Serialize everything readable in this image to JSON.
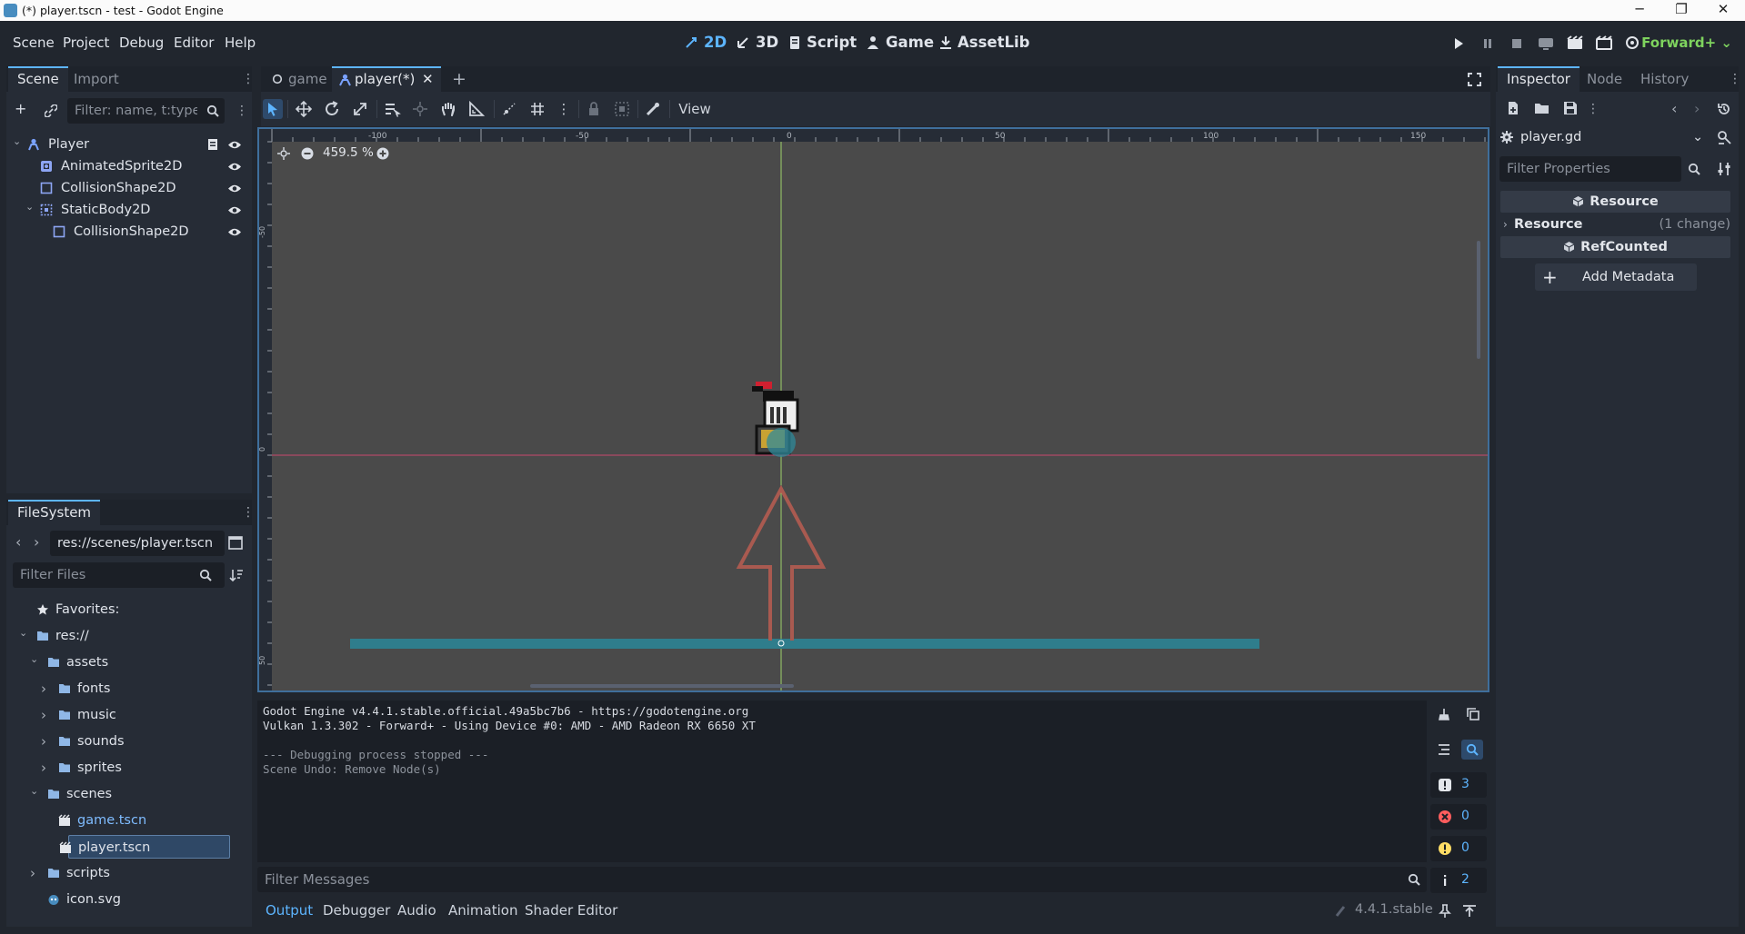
{
  "window": {
    "title": "(*) player.tscn - test - Godot Engine",
    "minimize": "─",
    "maximize": "❐",
    "close": "✕"
  },
  "menu": [
    "Scene",
    "Project",
    "Debug",
    "Editor",
    "Help"
  ],
  "workspaces": [
    {
      "label": "2D",
      "icon": "2d-icon",
      "active": true
    },
    {
      "label": "3D",
      "icon": "3d-icon"
    },
    {
      "label": "Script",
      "icon": "script-icon"
    },
    {
      "label": "Game",
      "icon": "game-icon"
    },
    {
      "label": "AssetLib",
      "icon": "assetlib-icon"
    }
  ],
  "renderer": "Forward+",
  "colors": {
    "accent": "#5db5ff",
    "renderer": "#7ed35e",
    "panel": "#262c36",
    "viewport": "#4a4a4a"
  },
  "scene_dock": {
    "tabs": [
      "Scene",
      "Import"
    ],
    "filter_placeholder": "Filter: name, t:type, g:group",
    "nodes": [
      {
        "label": "Player",
        "icon": "character-body-icon",
        "depth": 0,
        "expanded": true,
        "has_script": true
      },
      {
        "label": "AnimatedSprite2D",
        "icon": "animated-sprite-icon",
        "depth": 1
      },
      {
        "label": "CollisionShape2D",
        "icon": "collision-shape-icon",
        "depth": 1
      },
      {
        "label": "StaticBody2D",
        "icon": "static-body-icon",
        "depth": 1,
        "expanded": true
      },
      {
        "label": "CollisionShape2D",
        "icon": "collision-shape-icon",
        "depth": 2
      }
    ]
  },
  "filesystem": {
    "tab": "FileSystem",
    "path": "res://scenes/player.tscn",
    "filter_placeholder": "Filter Files",
    "items": [
      {
        "label": "Favorites:",
        "icon": "star-icon",
        "depth": 0
      },
      {
        "label": "res://",
        "icon": "folder-icon",
        "depth": 0,
        "expanded": true
      },
      {
        "label": "assets",
        "icon": "folder-icon",
        "depth": 1,
        "expanded": true
      },
      {
        "label": "fonts",
        "icon": "folder-icon",
        "depth": 2,
        "collapsed": true
      },
      {
        "label": "music",
        "icon": "folder-icon",
        "depth": 2,
        "collapsed": true
      },
      {
        "label": "sounds",
        "icon": "folder-icon",
        "depth": 2,
        "collapsed": true
      },
      {
        "label": "sprites",
        "icon": "folder-icon",
        "depth": 2,
        "collapsed": true
      },
      {
        "label": "scenes",
        "icon": "folder-icon",
        "depth": 1,
        "expanded": true
      },
      {
        "label": "game.tscn",
        "icon": "scene-file-icon",
        "depth": 2,
        "open": true
      },
      {
        "label": "player.tscn",
        "icon": "scene-file-icon",
        "depth": 2,
        "selected": true
      },
      {
        "label": "scripts",
        "icon": "folder-icon",
        "depth": 1,
        "collapsed": true
      },
      {
        "label": "icon.svg",
        "icon": "godot-icon",
        "depth": 1
      }
    ]
  },
  "scene_tabs": [
    {
      "label": "game",
      "icon": "node-icon"
    },
    {
      "label": "player(*)",
      "icon": "character-body-icon",
      "active": true
    }
  ],
  "toolbar": {
    "view_menu": "View"
  },
  "viewport": {
    "zoom": "459.5 %",
    "ruler_x": [
      "-100",
      "-50",
      "0",
      "50",
      "100",
      "150"
    ],
    "ruler_y": [
      "-50",
      "0",
      "50"
    ]
  },
  "output": {
    "lines": [
      {
        "text": "Godot Engine v4.4.1.stable.official.49a5bc7b6 - https://godotengine.org",
        "muted": false
      },
      {
        "text": "Vulkan 1.3.302 - Forward+ - Using Device #0: AMD - AMD Radeon RX 6650 XT",
        "muted": false
      },
      {
        "text": "",
        "muted": false
      },
      {
        "text": "--- Debugging process stopped ---",
        "muted": true
      },
      {
        "text": "Scene Undo: Remove Node(s)",
        "muted": true
      }
    ],
    "counts": {
      "messages": "3",
      "errors": "0",
      "warnings": "0",
      "info": "2"
    },
    "filter_placeholder": "Filter Messages"
  },
  "bottom_tabs": [
    "Output",
    "Debugger",
    "Audio",
    "Animation",
    "Shader Editor"
  ],
  "version": "4.4.1.stable",
  "inspector": {
    "tabs": [
      "Inspector",
      "Node",
      "History"
    ],
    "resource_path": "player.gd",
    "filter_placeholder": "Filter Properties",
    "section_resource": "Resource",
    "group_resource": "Resource",
    "group_resource_note": "(1 change)",
    "section_refcounted": "RefCounted",
    "add_metadata": "Add Metadata"
  }
}
